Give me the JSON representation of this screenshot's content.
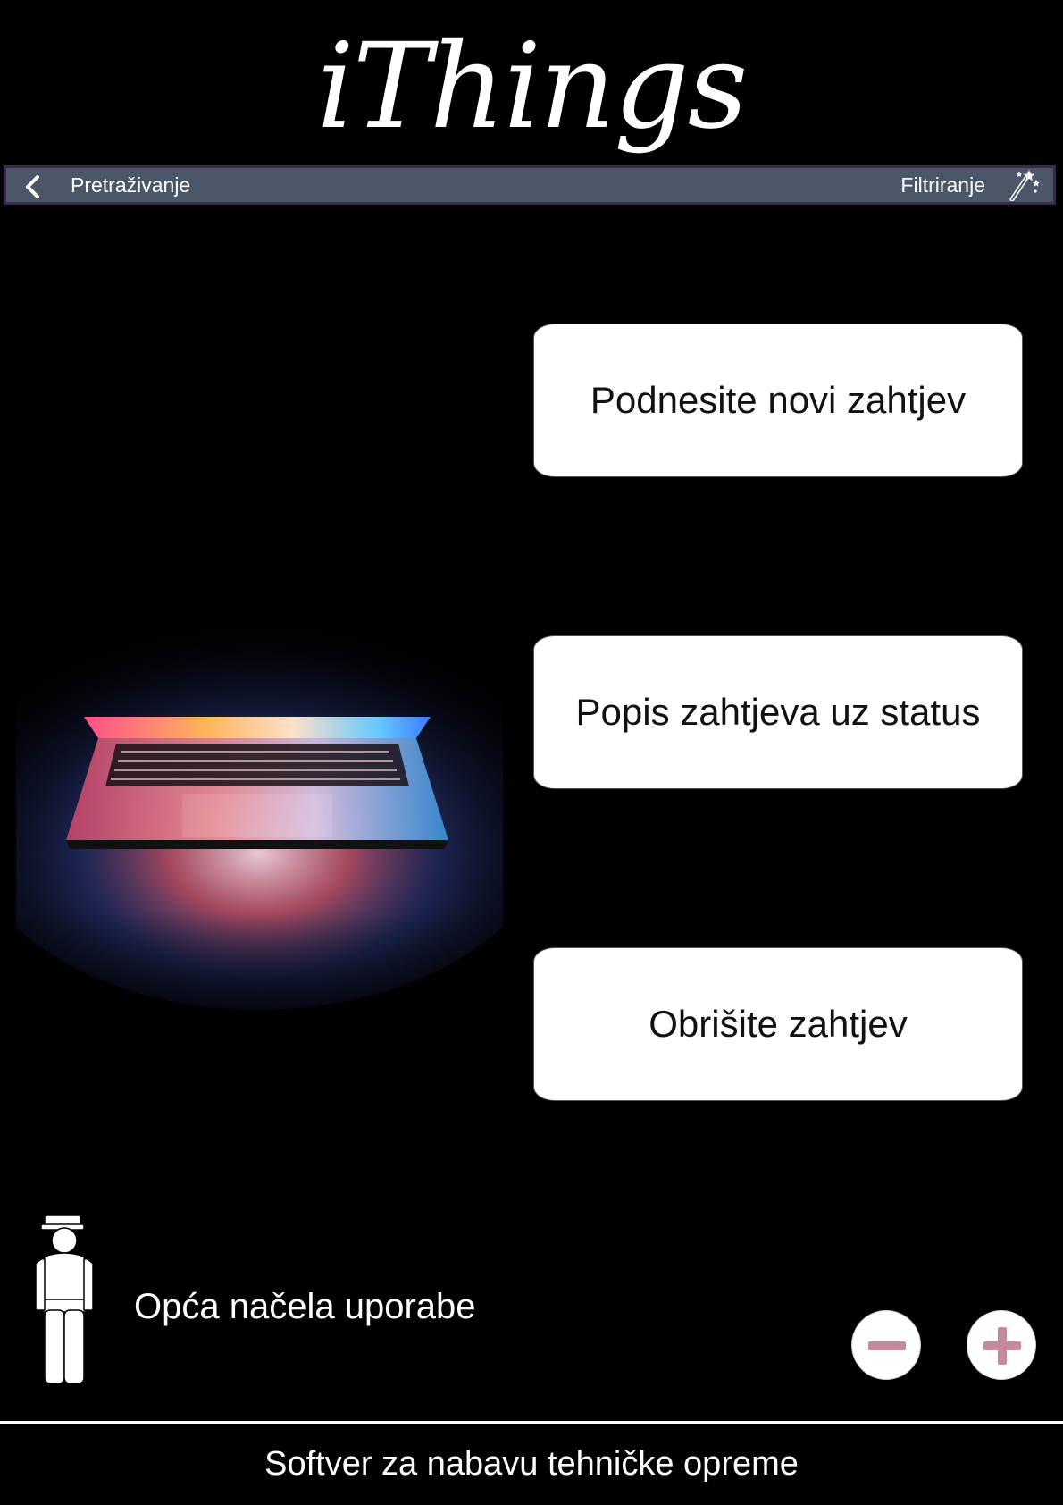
{
  "app": {
    "logo_text": "iThings"
  },
  "navbar": {
    "back_icon": "chevron-left-icon",
    "search_label": "Pretraživanje",
    "filter_label": "Filtriranje",
    "filter_icon": "magic-wand-icon",
    "background_color": "#4b5667"
  },
  "actions": {
    "submit_request": "Podnesite novi zahtjev",
    "request_list": "Popis zahtjeva uz status",
    "delete_request": "Obrišite zahtjev"
  },
  "usage": {
    "icon": "person-with-cap-icon",
    "label": "Opća načela uporabe"
  },
  "zoom": {
    "zoom_out_icon": "minus-icon",
    "zoom_in_icon": "plus-icon",
    "icon_color": "#c48a9c"
  },
  "footer": {
    "text": "Softver za nabavu tehničke opreme"
  }
}
